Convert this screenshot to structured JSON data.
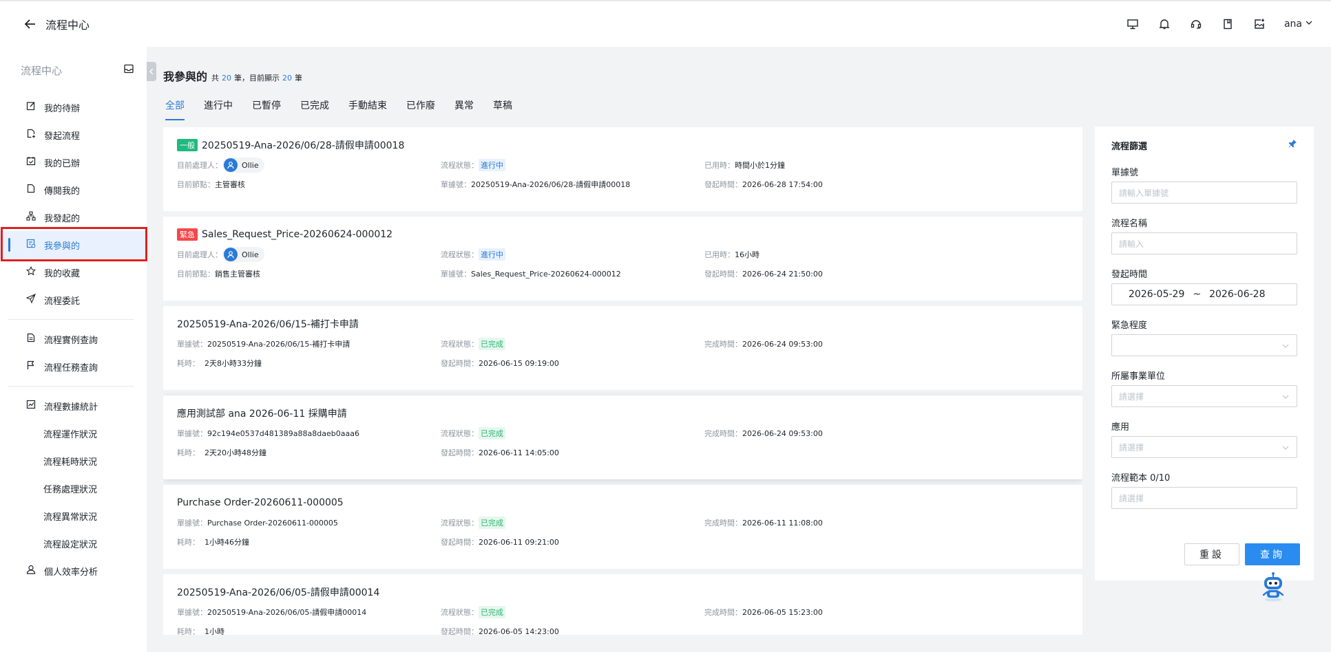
{
  "header": {
    "title": "流程中心",
    "user": "ana",
    "icons": [
      "monitor-icon",
      "bell-icon",
      "headset-icon",
      "book-icon",
      "image-add-icon"
    ]
  },
  "sidebar": {
    "title": "流程中心",
    "items": [
      {
        "label": "我的待辦",
        "icon": "edit-icon"
      },
      {
        "label": "發起流程",
        "icon": "file-add-icon"
      },
      {
        "label": "我的已辦",
        "icon": "calendar-check-icon"
      },
      {
        "label": "傳閱我的",
        "icon": "file-icon"
      },
      {
        "label": "我發起的",
        "icon": "org-icon"
      },
      {
        "label": "我參與的",
        "icon": "participate-icon",
        "active": true
      },
      {
        "label": "我的收藏",
        "icon": "star-icon"
      },
      {
        "label": "流程委託",
        "icon": "send-icon"
      }
    ],
    "items2": [
      {
        "label": "流程實例查詢",
        "icon": "doc-search-icon"
      },
      {
        "label": "流程任務查詢",
        "icon": "flag-icon"
      }
    ],
    "stats": {
      "label": "流程數據統計",
      "icon": "chart-icon"
    },
    "stats_sub": [
      "流程運作狀況",
      "流程耗時狀況",
      "任務處理狀況",
      "流程異常狀況",
      "流程設定狀況"
    ],
    "efficiency": {
      "label": "個人效率分析",
      "icon": "person-icon"
    }
  },
  "main": {
    "title": "我參與的",
    "total_prefix": "共",
    "total": "20",
    "total_suffix": "筆，目前顯示",
    "shown": "20",
    "shown_suffix": "筆",
    "tabs": [
      "全部",
      "進行中",
      "已暫停",
      "已完成",
      "手動結束",
      "已作廢",
      "異常",
      "草稿"
    ],
    "active_tab": "全部"
  },
  "cards": [
    {
      "tag": "一般",
      "tag_color": "#20b980",
      "title": "20250519-Ana-2026/06/28-請假申請00018",
      "r1": [
        {
          "k": "目前處理人：",
          "person": "Ollie"
        },
        {
          "k": "流程狀態：",
          "status": "進行中",
          "status_type": "blue"
        },
        {
          "k": "已用時：",
          "v": "時間小於1分鐘"
        }
      ],
      "r2": [
        {
          "k": "目前節點：",
          "v": "主管審核"
        },
        {
          "k": "單據號：",
          "v": "20250519-Ana-2026/06/28-請假申請00018"
        },
        {
          "k": "發起時間：",
          "v": "2026-06-28 17:54:00"
        }
      ]
    },
    {
      "tag": "緊急",
      "tag_color": "#f5484a",
      "title": "Sales_Request_Price-20260624-000012",
      "r1": [
        {
          "k": "目前處理人：",
          "person": "Ollie"
        },
        {
          "k": "流程狀態：",
          "status": "進行中",
          "status_type": "blue"
        },
        {
          "k": "已用時：",
          "v": "16小時"
        }
      ],
      "r2": [
        {
          "k": "目前節點：",
          "v": "銷售主管審核"
        },
        {
          "k": "單據號：",
          "v": "Sales_Request_Price-20260624-000012"
        },
        {
          "k": "發起時間：",
          "v": "2026-06-24 21:50:00"
        }
      ]
    },
    {
      "title": "20250519-Ana-2026/06/15-補打卡申請",
      "r1": [
        {
          "k": "單據號：",
          "v": "20250519-Ana-2026/06/15-補打卡申請"
        },
        {
          "k": "流程狀態：",
          "status": "已完成",
          "status_type": "green"
        },
        {
          "k": "完成時間：",
          "v": "2026-06-24 09:53:00"
        }
      ],
      "r2": [
        {
          "k": "耗時：",
          "v": "  2天8小時33分鐘"
        },
        {
          "k": "發起時間：",
          "v": "2026-06-15 09:19:00"
        }
      ]
    },
    {
      "title": "應用測試部 ana 2026-06-11 採購申請",
      "hl": true,
      "r1": [
        {
          "k": "單據號：",
          "v": "92c194e0537d481389a88a8daeb0aaa6"
        },
        {
          "k": "流程狀態：",
          "status": "已完成",
          "status_type": "green"
        },
        {
          "k": "完成時間：",
          "v": "2026-06-24 09:53:00"
        }
      ],
      "r2": [
        {
          "k": "耗時：",
          "v": "  2天20小時48分鐘"
        },
        {
          "k": "發起時間：",
          "v": "2026-06-11 14:05:00"
        }
      ]
    },
    {
      "title": "Purchase Order-20260611-000005",
      "r1": [
        {
          "k": "單據號：",
          "v": "Purchase Order-20260611-000005"
        },
        {
          "k": "流程狀態：",
          "status": "已完成",
          "status_type": "green"
        },
        {
          "k": "完成時間：",
          "v": "2026-06-11 11:08:00"
        }
      ],
      "r2": [
        {
          "k": "耗時：",
          "v": "  1小時46分鐘"
        },
        {
          "k": "發起時間：",
          "v": "2026-06-11 09:21:00"
        }
      ]
    },
    {
      "title": "20250519-Ana-2026/06/05-請假申請00014",
      "r1": [
        {
          "k": "單據號：",
          "v": "20250519-Ana-2026/06/05-請假申請00014"
        },
        {
          "k": "流程狀態：",
          "status": "已完成",
          "status_type": "green"
        },
        {
          "k": "完成時間：",
          "v": "2026-06-05 15:23:00"
        }
      ],
      "r2": [
        {
          "k": "耗時：",
          "v": "  1小時"
        },
        {
          "k": "發起時間：",
          "v": "2026-06-05 14:23:00"
        }
      ]
    }
  ],
  "filter": {
    "title": "流程篩選",
    "doc_no_label": "單據號",
    "doc_no_placeholder": "請輸入單據號",
    "name_label": "流程名稱",
    "name_placeholder": "請輸入",
    "start_label": "發起時間",
    "date_from": "2026-05-29",
    "date_sep": "~",
    "date_to": "2026-06-28",
    "urgency_label": "緊急程度",
    "urgency_value": "",
    "unit_label": "所屬事業單位",
    "unit_placeholder": "請選擇",
    "app_label": "應用",
    "app_placeholder": "請選擇",
    "template_label": "流程範本 0/10",
    "template_placeholder": "請選擇",
    "reset": "重設",
    "query": "查詢"
  },
  "colors": {
    "accent": "#2a7bd8",
    "highlight_box": "#e02020"
  }
}
